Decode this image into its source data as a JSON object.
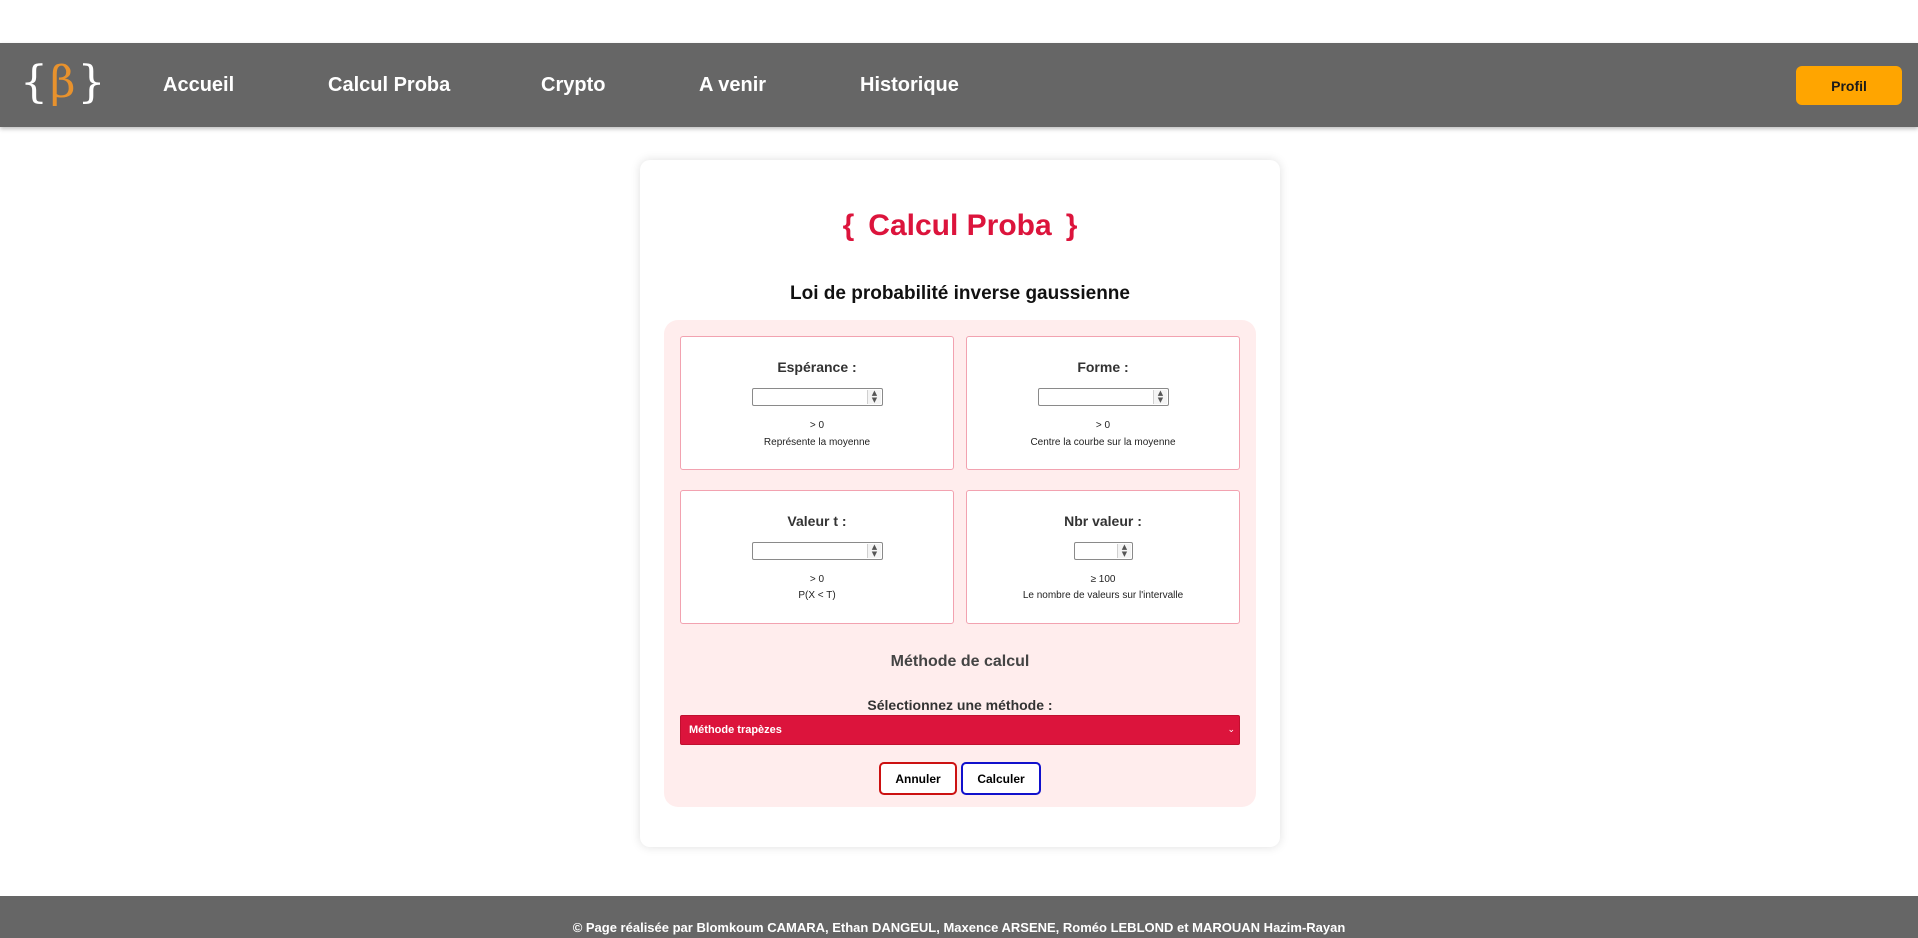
{
  "nav": {
    "logo": {
      "left_brace": "{",
      "symbol": "β",
      "right_brace": "}"
    },
    "links": [
      "Accueil",
      "Calcul Proba",
      "Crypto",
      "A venir",
      "Historique"
    ],
    "profile_label": "Profil"
  },
  "card": {
    "title_open": "{",
    "title": "Calcul Proba",
    "title_close": "}",
    "subtitle": "Loi de probabilité inverse gaussienne",
    "params": [
      {
        "label": "Espérance :",
        "value": "",
        "constraint": "> 0",
        "description": "Représente la moyenne"
      },
      {
        "label": "Forme :",
        "value": "",
        "constraint": "> 0",
        "description": "Centre la courbe sur la moyenne"
      },
      {
        "label": "Valeur t :",
        "value": "",
        "constraint": "> 0",
        "description": "P(X < T)"
      },
      {
        "label": "Nbr valeur :",
        "value": "",
        "constraint": "≥ 100",
        "description": "Le nombre de valeurs sur l'intervalle"
      }
    ],
    "method_title": "Méthode de calcul",
    "select_label": "Sélectionnez une méthode :",
    "selected_method": "Méthode trapèzes",
    "cancel_label": "Annuler",
    "submit_label": "Calculer"
  },
  "footer": {
    "text": "© Page réalisée par Blomkoum CAMARA, Ethan DANGEUL, Maxence ARSENE, Roméo LEBLOND et MAROUAN Hazim-Rayan"
  },
  "colors": {
    "accent": "#dc143c",
    "nav_bg": "#666666",
    "profile_button": "#ffa500",
    "form_bg": "#ffeded",
    "logo_symbol": "#e8922d"
  }
}
